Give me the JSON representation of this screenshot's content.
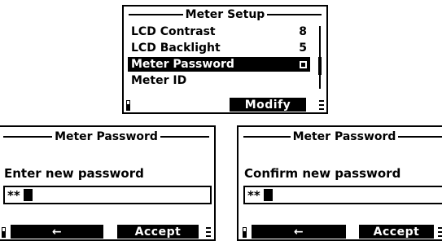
{
  "setup_screen": {
    "title": "Meter Setup",
    "items": [
      {
        "label": "LCD Contrast",
        "value": "8"
      },
      {
        "label": "LCD Backlight",
        "value": "5"
      },
      {
        "label": "Meter Password",
        "value": ""
      },
      {
        "label": "Meter ID",
        "value": ""
      }
    ],
    "selected_index": 2,
    "softkey_right": "Modify"
  },
  "enter_screen": {
    "title": "Meter Password",
    "prompt": "Enter new password",
    "entry": "**",
    "softkey_left_icon": "left-arrow-icon",
    "softkey_left": "←",
    "softkey_right": "Accept"
  },
  "confirm_screen": {
    "title": "Meter Password",
    "prompt": "Confirm new password",
    "entry": "**",
    "softkey_left_icon": "left-arrow-icon",
    "softkey_left": "←",
    "softkey_right": "Accept"
  },
  "colors": {
    "display_bg": "#ffffff",
    "display_fg": "#000000"
  }
}
